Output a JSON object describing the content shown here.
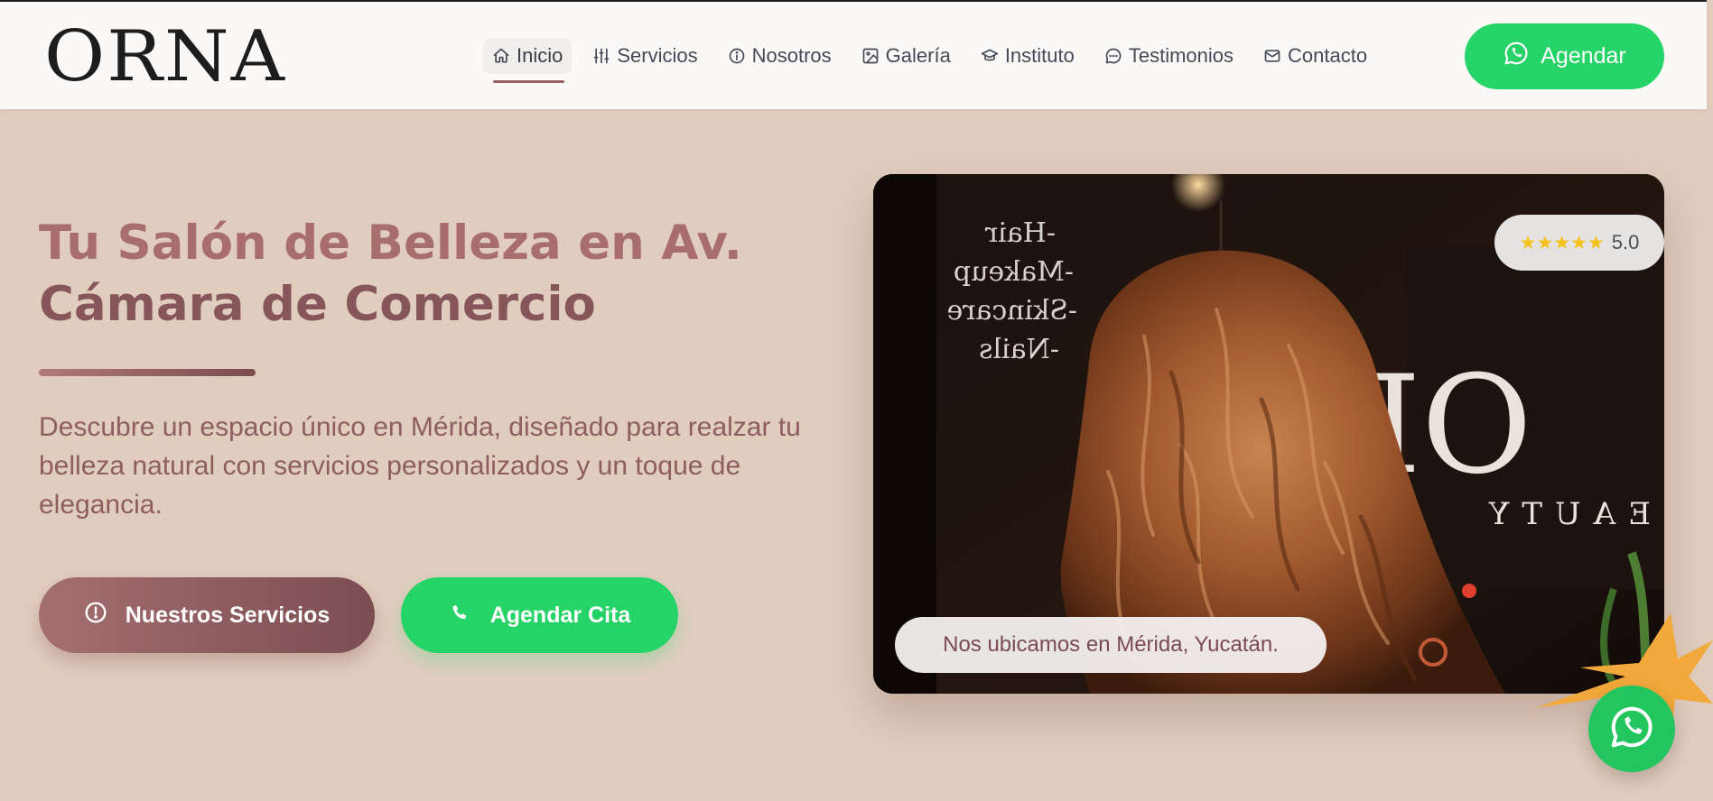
{
  "brand": {
    "logo": "ORNA"
  },
  "nav": {
    "items": [
      {
        "label": "Inicio",
        "icon": "home-icon"
      },
      {
        "label": "Servicios",
        "icon": "sliders-icon"
      },
      {
        "label": "Nosotros",
        "icon": "info-icon"
      },
      {
        "label": "Galería",
        "icon": "image-icon"
      },
      {
        "label": "Instituto",
        "icon": "graduation-cap-icon"
      },
      {
        "label": "Testimonios",
        "icon": "chat-bubble-icon"
      },
      {
        "label": "Contacto",
        "icon": "envelope-icon"
      }
    ],
    "cta_label": "Agendar",
    "active": "Inicio"
  },
  "hero": {
    "title_line1": "Tu Salón de Belleza en Av.",
    "title_line2": "Cámara de Comercio",
    "description": "Descubre un espacio único en Mérida, diseñado para realzar tu belleza natural con servicios personalizados y un toque de elegancia.",
    "primary_button": "Nuestros Servicios",
    "secondary_button": "Agendar Cita"
  },
  "photo": {
    "rating_stars": "★★★★★",
    "rating_value": "5.0",
    "location": "Nos ubicamos en Mérida, Yucatán.",
    "window_text": [
      "-Hair",
      "-Makeup",
      "-Skincare",
      "-Nails"
    ]
  },
  "colors": {
    "background": "#e1cdbe",
    "accent": "#a86e6e",
    "accent_dark": "#86565a",
    "whatsapp": "#25d366",
    "navbar": "#fbf9f8"
  }
}
